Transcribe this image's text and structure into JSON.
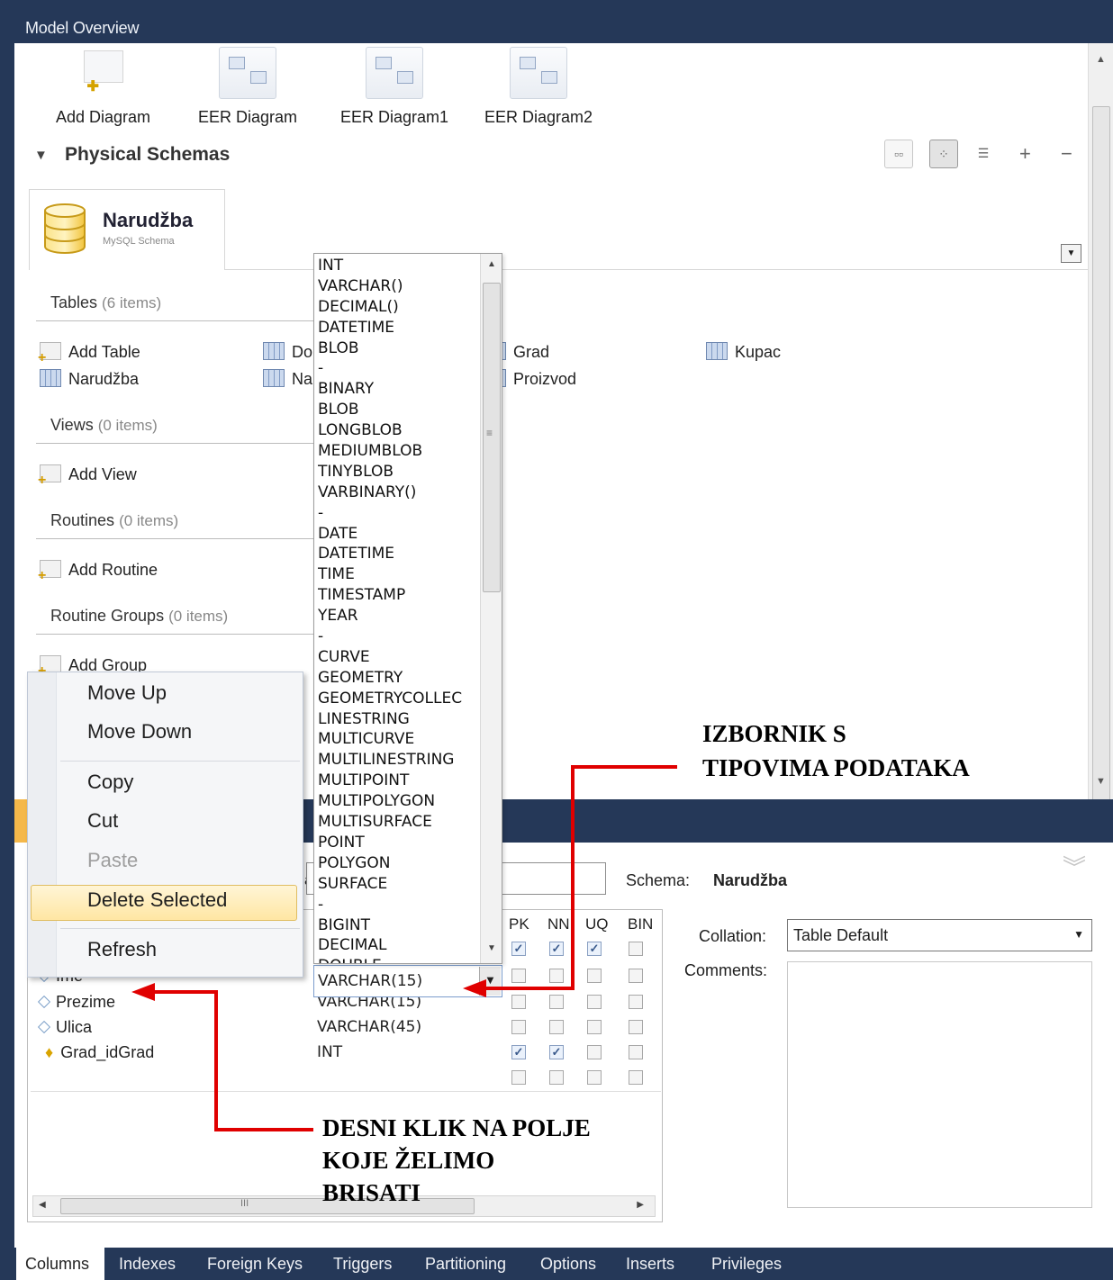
{
  "header": {
    "title": "Model Overview"
  },
  "diagrams": [
    {
      "label": "Add Diagram"
    },
    {
      "label": "EER Diagram"
    },
    {
      "label": "EER Diagram1"
    },
    {
      "label": "EER Diagram2"
    }
  ],
  "physical_schemas": {
    "title": "Physical Schemas",
    "schema": {
      "name": "Narudžba",
      "subtitle": "MySQL Schema"
    }
  },
  "sections": {
    "tables": {
      "title": "Tables",
      "count": "(6 items)",
      "items": [
        "Add Table",
        "Do",
        "Grad",
        "Kupac",
        "Narudžba",
        "Na",
        "Proizvod"
      ]
    },
    "views": {
      "title": "Views",
      "count": "(0 items)",
      "add": "Add View"
    },
    "routines": {
      "title": "Routines",
      "count": "(0 items)",
      "add": "Add Routine"
    },
    "routine_groups": {
      "title": "Routine Groups",
      "count": "(0 items)",
      "add": "Add Group"
    }
  },
  "type_list": [
    "INT",
    "VARCHAR()",
    "DECIMAL()",
    "DATETIME",
    "BLOB",
    "-",
    "BINARY",
    "BLOB",
    "LONGBLOB",
    "MEDIUMBLOB",
    "TINYBLOB",
    "VARBINARY()",
    "-",
    "DATE",
    "DATETIME",
    "TIME",
    "TIMESTAMP",
    "YEAR",
    "-",
    "CURVE",
    "GEOMETRY",
    "GEOMETRYCOLLEC",
    "LINESTRING",
    "MULTICURVE",
    "MULTILINESTRING",
    "MULTIPOINT",
    "MULTIPOLYGON",
    "MULTISURFACE",
    "POINT",
    "POLYGON",
    "SURFACE",
    "-",
    "BIGINT",
    "DECIMAL",
    "DOUBLE"
  ],
  "context_menu": {
    "move_up": "Move Up",
    "move_down": "Move Down",
    "copy": "Copy",
    "cut": "Cut",
    "paste": "Paste",
    "delete_selected": "Delete Selected",
    "refresh": "Refresh"
  },
  "editor": {
    "name_label_fragment": "a",
    "schema_label": "Schema:",
    "schema_value": "Narudžba",
    "collation_label": "Collation:",
    "collation_value": "Table Default",
    "comments_label": "Comments:",
    "grid_headers": [
      "PK",
      "NN",
      "UQ",
      "BIN"
    ],
    "columns": [
      {
        "name": "",
        "type": "",
        "flags": [
          true,
          true,
          true,
          false
        ]
      },
      {
        "name": "Ime",
        "type": "VARCHAR(15)",
        "flags": [
          false,
          false,
          false,
          false
        ]
      },
      {
        "name": "Prezime",
        "type": "VARCHAR(15)",
        "flags": [
          false,
          false,
          false,
          false
        ]
      },
      {
        "name": "Ulica",
        "type": "VARCHAR(45)",
        "flags": [
          false,
          false,
          false,
          false
        ]
      },
      {
        "name": "Grad_idGrad",
        "type": "INT",
        "flags": [
          true,
          true,
          false,
          false
        ]
      },
      {
        "name": "",
        "type": "",
        "flags": [
          false,
          false,
          false,
          false
        ]
      }
    ],
    "hscroll_grip": "III"
  },
  "bottom_tabs": [
    "Columns",
    "Indexes",
    "Foreign Keys",
    "Triggers",
    "Partitioning",
    "Options",
    "Inserts",
    "Privileges"
  ],
  "annotations": {
    "menu_line1": "IZBORNIK S",
    "menu_line2": "TIPOVIMA PODATAKA",
    "click_line1": "DESNI KLIK NA POLJE",
    "click_line2": "KOJE ŽELIMO",
    "click_line3": "BRISATI"
  },
  "colors": {
    "header_bg": "#253858",
    "accent": "#f5b84a",
    "arrow": "#e00000",
    "menu_highlight": "#ffe6a3"
  }
}
